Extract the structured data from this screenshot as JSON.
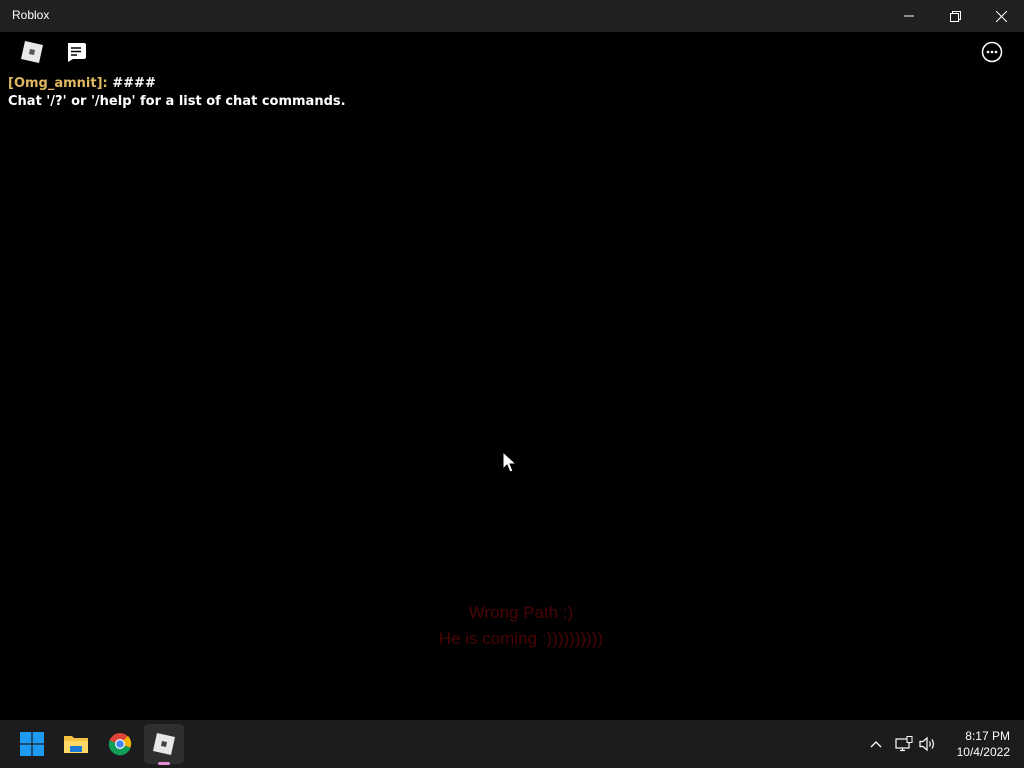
{
  "window": {
    "title": "Roblox",
    "controls": [
      "minimize",
      "restore",
      "close"
    ]
  },
  "game_topbar": {
    "left_icons": [
      "roblox-menu-icon",
      "chat-icon"
    ],
    "right_icons": [
      "more-options-icon"
    ]
  },
  "chat": {
    "messages": [
      {
        "user": "[Omg_amnit]:",
        "text": " ####"
      },
      {
        "system": "Chat '/?' or '/help' for a list of chat commands."
      }
    ]
  },
  "center_message": {
    "line1": "Wrong Path :)",
    "line2": "He is coming :))))))))))",
    "color": "#4a0404"
  },
  "taskbar": {
    "apps": [
      "windows-start-icon",
      "file-explorer-icon",
      "chrome-icon",
      "roblox-icon"
    ],
    "active_app": "roblox",
    "tray_icons": [
      "show-hidden-icons-chevron",
      "network-icon",
      "volume-icon"
    ],
    "time": "8:17 PM",
    "date": "10/4/2022"
  }
}
